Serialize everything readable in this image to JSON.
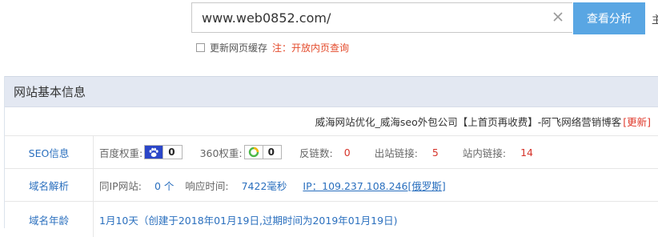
{
  "search": {
    "value": "www.web0852.com/",
    "button_label": "查看分析",
    "edge_text": "主"
  },
  "options": {
    "refresh_label": "更新网页缓存",
    "note_label": "注：开放内页查询"
  },
  "panel": {
    "title": "网站基本信息",
    "site_title": "威海网站优化_威海seo外包公司【上首页再收费】-阿飞网络营销博客",
    "update_label": "[更新]",
    "seo": {
      "label": "SEO信息",
      "baidu_label": "百度权重:",
      "baidu_value": "0",
      "so360_label": "360权重:",
      "so360_value": "0",
      "backlinks_label": "反链数:",
      "backlinks_value": "0",
      "outlinks_label": "出站链接:",
      "outlinks_value": "5",
      "inlinks_label": "站内链接:",
      "inlinks_value": "14"
    },
    "dns": {
      "label": "域名解析",
      "same_ip_label": "同IP网站:",
      "same_ip_value": "0 个",
      "response_label": "响应时间:",
      "response_value": "7422毫秒",
      "ip_link": "IP：109.237.108.246[俄罗斯]"
    },
    "domain_age": {
      "label": "域名年龄",
      "value": "1月10天（创建于2018年01月19日,过期时间为2019年01月19日)"
    }
  },
  "colors": {
    "accent": "#59a6e3",
    "header_bg": "#e3e8f2",
    "label_blue": "#2a6fbe",
    "value_red": "#d6342b"
  }
}
